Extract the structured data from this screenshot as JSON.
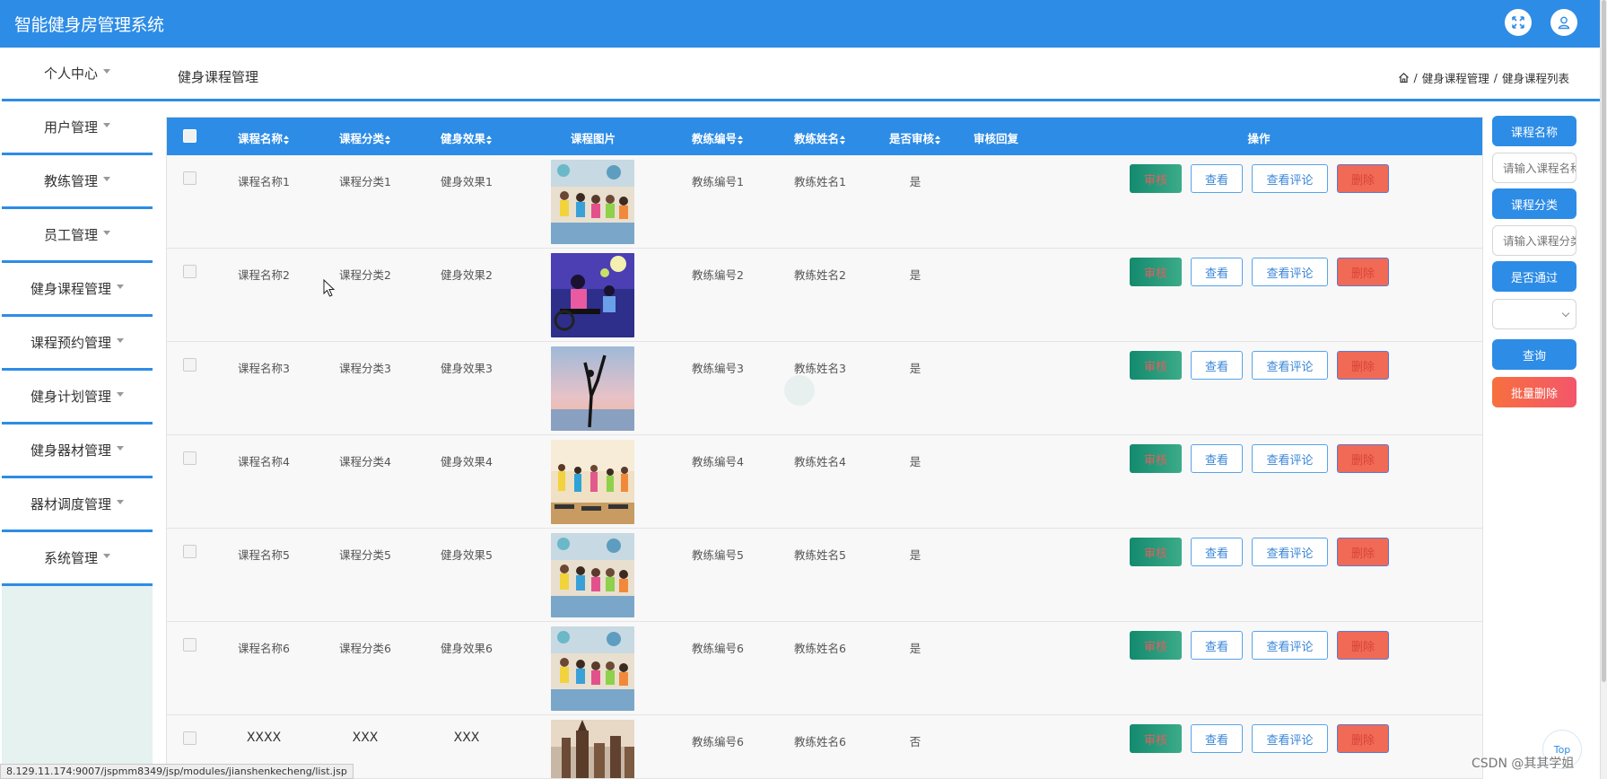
{
  "app": {
    "title": "智能健身房管理系统"
  },
  "topbar_icons": [
    "fullscreen-icon",
    "user-icon"
  ],
  "sidebar": {
    "items": [
      {
        "label": "个人中心"
      },
      {
        "label": "用户管理"
      },
      {
        "label": "教练管理"
      },
      {
        "label": "员工管理"
      },
      {
        "label": "健身课程管理"
      },
      {
        "label": "课程预约管理"
      },
      {
        "label": "健身计划管理"
      },
      {
        "label": "健身器材管理"
      },
      {
        "label": "器材调度管理"
      },
      {
        "label": "系统管理"
      }
    ]
  },
  "page": {
    "title": "健身课程管理",
    "breadcrumb": [
      "健身课程管理",
      "健身课程列表"
    ],
    "breadcrumb_sep": "/"
  },
  "table": {
    "headers": {
      "name": "课程名称",
      "category": "课程分类",
      "effect": "健身效果",
      "image": "课程图片",
      "coach_no": "教练编号",
      "coach_name": "教练姓名",
      "approved": "是否审核",
      "reply": "审核回复",
      "actions": "操作"
    },
    "rows": [
      {
        "name": "课程名称1",
        "category": "课程分类1",
        "effect": "健身效果1",
        "image": "group-yoga-photo",
        "coach_no": "教练编号1",
        "coach_name": "教练姓名1",
        "approved": "是",
        "reply": ""
      },
      {
        "name": "课程名称2",
        "category": "课程分类2",
        "effect": "健身效果2",
        "image": "spinning-class-photo",
        "coach_no": "教练编号2",
        "coach_name": "教练姓名2",
        "approved": "是",
        "reply": ""
      },
      {
        "name": "课程名称3",
        "category": "课程分类3",
        "effect": "健身效果3",
        "image": "yoga-silhouette-photo",
        "coach_no": "教练编号3",
        "coach_name": "教练姓名3",
        "approved": "是",
        "reply": ""
      },
      {
        "name": "课程名称4",
        "category": "课程分类4",
        "effect": "健身效果4",
        "image": "step-aerobics-photo",
        "coach_no": "教练编号4",
        "coach_name": "教练姓名4",
        "approved": "是",
        "reply": ""
      },
      {
        "name": "课程名称5",
        "category": "课程分类5",
        "effect": "健身效果5",
        "image": "group-yoga-photo",
        "coach_no": "教练编号5",
        "coach_name": "教练姓名5",
        "approved": "是",
        "reply": ""
      },
      {
        "name": "课程名称6",
        "category": "课程分类6",
        "effect": "健身效果6",
        "image": "group-yoga-photo",
        "coach_no": "教练编号6",
        "coach_name": "教练姓名6",
        "approved": "是",
        "reply": ""
      },
      {
        "name": "XXXX",
        "category": "XXX",
        "effect": "XXX",
        "image": "cathedral-photo",
        "coach_no": "教练编号6",
        "coach_name": "教练姓名6",
        "approved": "否",
        "reply": ""
      }
    ],
    "action_labels": {
      "audit": "审核",
      "view": "查看",
      "comments": "查看评论",
      "delete": "删除"
    }
  },
  "filters": {
    "name_button": "课程名称",
    "name_placeholder": "请输入课程名称",
    "category_button": "课程分类",
    "category_placeholder": "请输入课程分类",
    "approved_button": "是否通过",
    "approved_value": "",
    "search_button": "查询",
    "batch_delete_button": "批量删除"
  },
  "colors": {
    "primary": "#2d8ce6",
    "audit_green": "#1a8f72",
    "delete_red": "#f06a55",
    "batch_delete": "#f46a57"
  },
  "statusbar": {
    "url": "8.129.11.174:9007/jspmm8349/jsp/modules/jianshenkecheng/list.jsp"
  },
  "watermark": "CSDN @其其学姐",
  "back_to_top": "Top"
}
